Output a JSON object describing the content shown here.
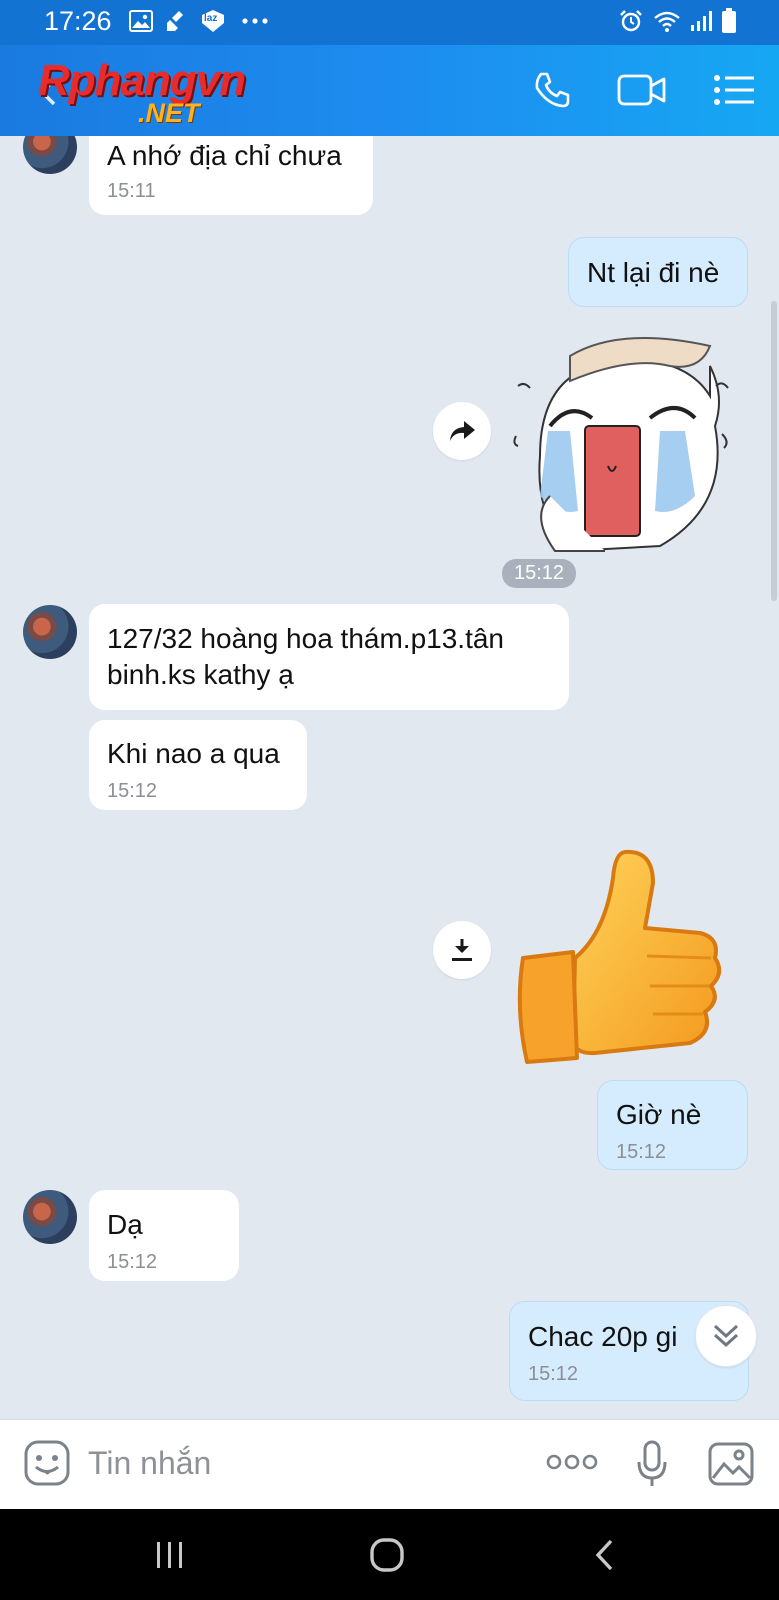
{
  "status_bar": {
    "time": "17:26",
    "left_icons": [
      "gallery-icon",
      "clean-icon",
      "lazada-icon",
      "more-dots-icon"
    ],
    "lazada_text": "laz",
    "right_icons": [
      "alarm-icon",
      "wifi-icon",
      "signal-icon",
      "battery-icon"
    ]
  },
  "header": {
    "logo_main": "Rphangvn",
    "logo_sub": ".NET",
    "actions": [
      "phone-icon",
      "video-call-icon",
      "menu-list-icon"
    ]
  },
  "messages": [
    {
      "side": "in",
      "text": "A nhớ địa chỉ chưa",
      "time": "15:11"
    },
    {
      "side": "out",
      "text": "Nt lại đi nè"
    },
    {
      "side": "out",
      "type": "sticker",
      "sticker": "crying-face-sticker",
      "time": "15:12"
    },
    {
      "side": "in",
      "text": "127/32 hoàng hoa thám.p13.tân binh.ks kathy ạ"
    },
    {
      "side": "in",
      "text": "Khi nao a qua",
      "time": "15:12"
    },
    {
      "side": "out",
      "type": "sticker",
      "sticker": "thumbs-up-sticker"
    },
    {
      "side": "out",
      "text": "Giờ nè",
      "time": "15:12"
    },
    {
      "side": "in",
      "text": "Dạ",
      "time": "15:12"
    },
    {
      "side": "out",
      "text": "Chac 20p gi",
      "time": "15:12"
    }
  ],
  "sticker_time": "15:12",
  "input": {
    "placeholder": "Tin nhắn"
  },
  "colors": {
    "header_start": "#1a7ae0",
    "header_end": "#16a7f3",
    "chat_bg": "#e2e8f0",
    "outgoing_bubble": "#d4ecfe",
    "incoming_bubble": "#ffffff"
  }
}
